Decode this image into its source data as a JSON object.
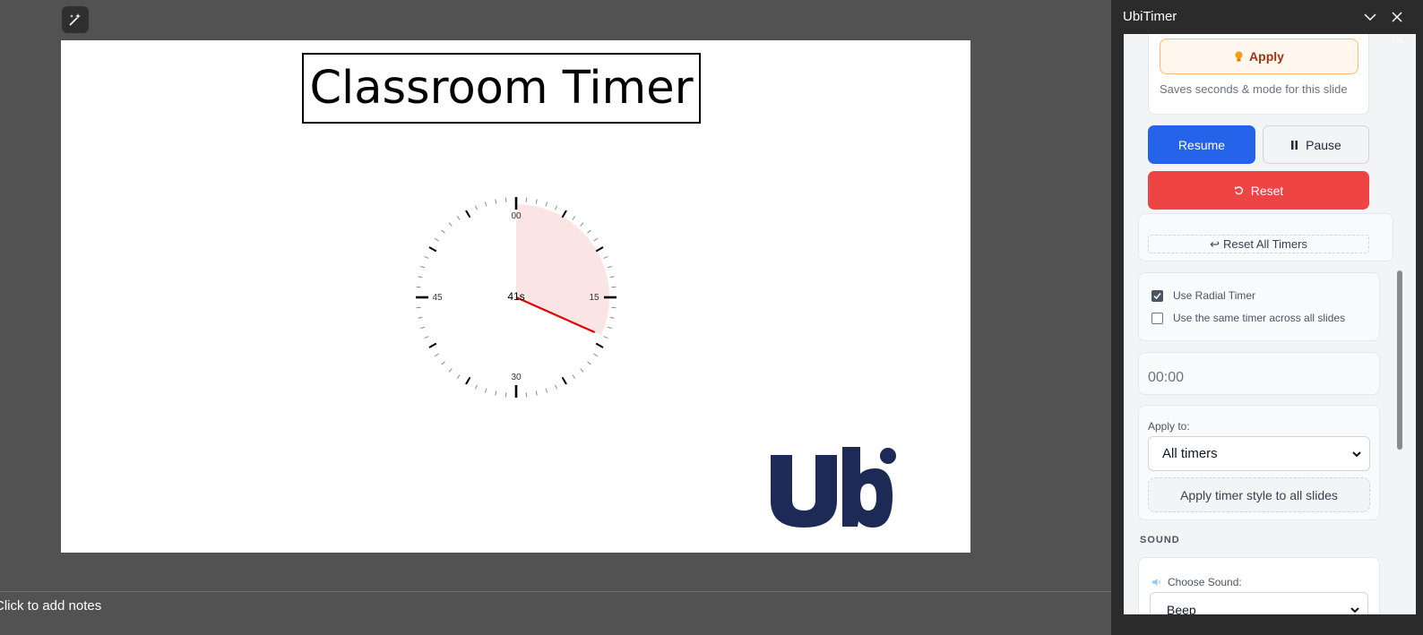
{
  "slide": {
    "title": "Classroom Timer",
    "clock": {
      "elapsed_seconds": 41,
      "center_label": "41s",
      "numbers": [
        "00",
        "15",
        "30",
        "45"
      ],
      "hand_color": "#e00000",
      "wedge_color": "#fbe4e4"
    },
    "logo_text": "Ubi",
    "logo_color": "#1c2a55"
  },
  "notes": {
    "placeholder": "Click to add notes"
  },
  "pane": {
    "title": "UbiTimer",
    "apply_label": "Apply",
    "apply_hint": "Saves seconds & mode for this slide",
    "resume_label": "Resume",
    "pause_label": "Pause",
    "reset_label": "Reset",
    "reset_all_label": "Reset All Timers",
    "use_radial_label": "Use Radial Timer",
    "use_radial_checked": true,
    "same_timer_label": "Use the same timer across all slides",
    "same_timer_checked": false,
    "time_value": "00:00",
    "apply_to_label": "Apply to:",
    "apply_to_value": "All timers",
    "style_button_label": "Apply timer style to all slides",
    "sound_heading": "SOUND",
    "choose_sound_label": "Choose Sound:",
    "sound_value": "Beep"
  },
  "colors": {
    "resume": "#2563eb",
    "reset": "#ef4444",
    "apply_bg": "#fff7ed",
    "apply_text": "#9a3412"
  },
  "icons": {
    "designer": "designer-wand-icon",
    "apply": "lightbulb-icon",
    "pause": "pause-icon",
    "reset": "reset-arrow-icon",
    "reset_all": "return-arrow-icon",
    "sound": "speaker-icon",
    "collapse": "chevron-down-icon",
    "close": "close-icon"
  }
}
